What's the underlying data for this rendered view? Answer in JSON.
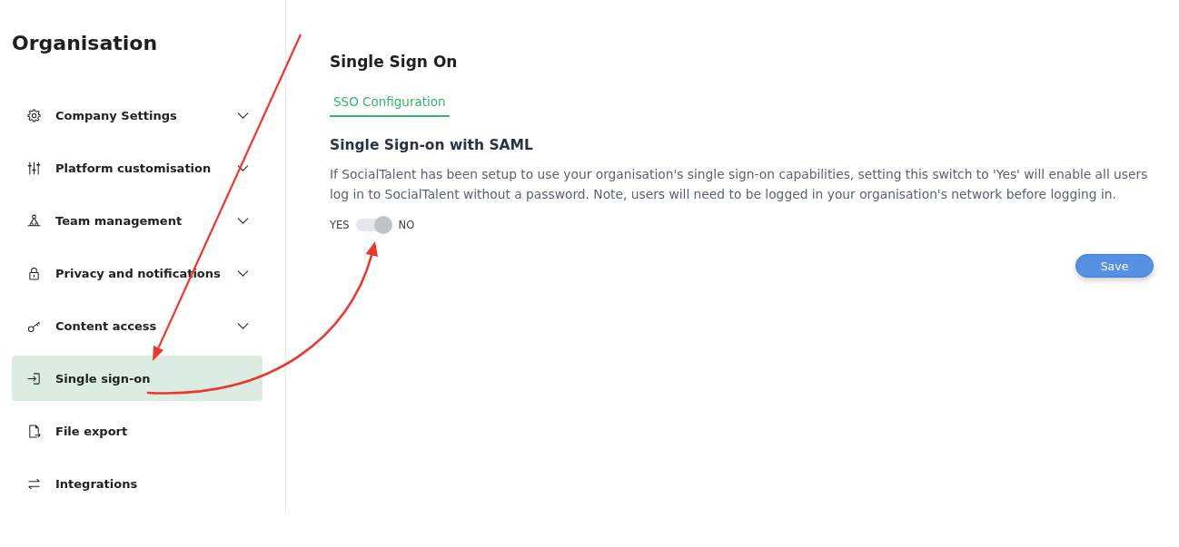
{
  "sidebar": {
    "title": "Organisation",
    "items": [
      {
        "label": "Company Settings",
        "kind": "group",
        "selected": false
      },
      {
        "label": "Platform customisation",
        "kind": "group",
        "selected": false
      },
      {
        "label": "Team management",
        "kind": "group",
        "selected": false
      },
      {
        "label": "Privacy and notifications",
        "kind": "group",
        "selected": false
      },
      {
        "label": "Content access",
        "kind": "group",
        "selected": false
      },
      {
        "label": "Single sign-on",
        "kind": "link",
        "selected": true
      },
      {
        "label": "File export",
        "kind": "link",
        "selected": false
      },
      {
        "label": "Integrations",
        "kind": "link",
        "selected": false
      }
    ]
  },
  "main": {
    "title": "Single Sign On",
    "tabs": [
      {
        "label": "SSO Configuration",
        "selected": true
      }
    ],
    "section": {
      "heading": "Single Sign-on with SAML",
      "description": "If SocialTalent has been setup to use your organisation's single sign-on capabilities, setting this switch to 'Yes' will enable all users log in to SocialTalent without a password. Note, users will need to be logged in your organisation's network before logging in.",
      "toggle": {
        "yes_label": "YES",
        "no_label": "NO",
        "no_selected": true
      }
    },
    "save_button": "Save"
  }
}
